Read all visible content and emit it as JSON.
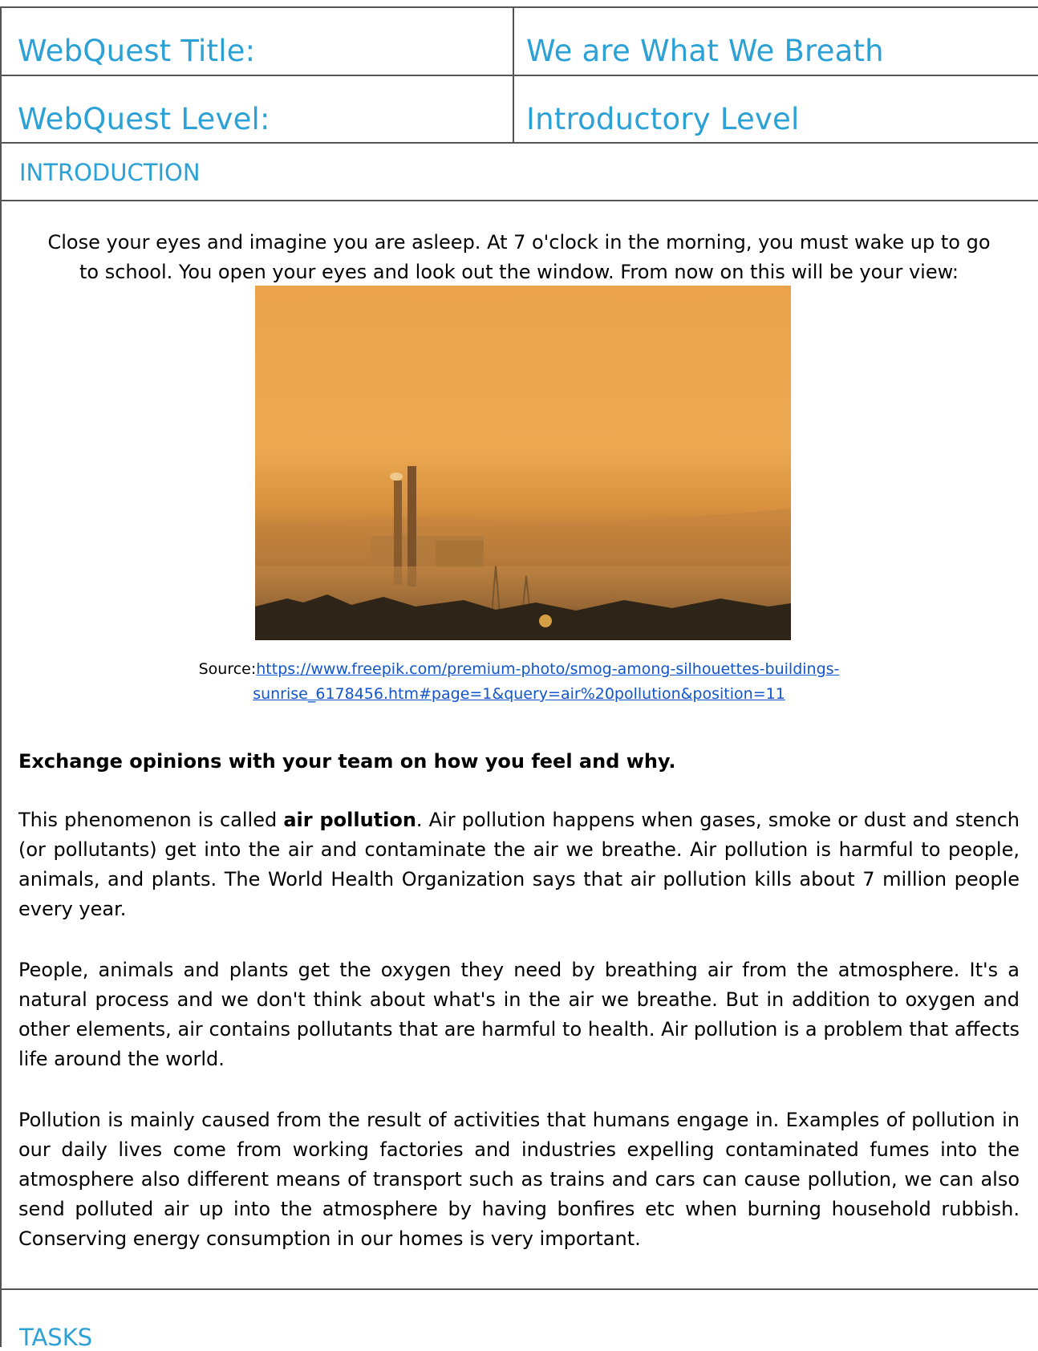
{
  "header": {
    "title_label": "WebQuest Title:",
    "title_value": "We are What We Breath",
    "level_label": "WebQuest Level:",
    "level_value": "Introductory Level"
  },
  "introduction": {
    "heading": "INTRODUCTION",
    "intro_line_1": "Close your eyes and imagine you are asleep. At 7 o'clock in the morning, you must wake up to go",
    "intro_line_2": "to school. You open your eyes and look out the window. From now on this will be your view:",
    "image_alt": "Smog among silhouettes of buildings and chimneys at sunrise",
    "caption_prefix": "Source:",
    "caption_link_line1": "https://www.freepik.com/premium-photo/smog-among-silhouettes-buildings-",
    "caption_link_line2": "sunrise_6178456.htm#page=1&query=air%20pollution&position=11",
    "prompt": "Exchange opinions with your team on how you feel and why.",
    "para1_before": "This phenomenon is called ",
    "para1_bold": "air pollution",
    "para1_after": ". Air pollution happens when gases, smoke or dust and stench (or pollutants) get into the air and contaminate the air we breathe. Air pollution is harmful to people, animals, and plants. The World Health Organization says that air pollution kills about 7 million people every year.",
    "para2": "People, animals and plants get the oxygen they need by breathing air from the atmosphere. It's a natural process and we don't think about what's in the air we breathe. But in addition to oxygen and other elements, air contains pollutants that are harmful to health. Air pollution is a problem that affects life around the world.",
    "para3": "Pollution is mainly caused from the result of activities that humans engage in. Examples of pollution in our daily lives come from working factories and industries expelling contaminated fumes into the atmosphere also different means of transport such as trains and cars can cause pollution, we can also send polluted air up into the atmosphere by having bonfires etc when burning household rubbish. Conserving energy consumption in our homes is very important."
  },
  "tasks": {
    "heading": "TASKS"
  },
  "colors": {
    "accent": "#2ba1d6",
    "link": "#1155cc",
    "border": "#555555"
  }
}
